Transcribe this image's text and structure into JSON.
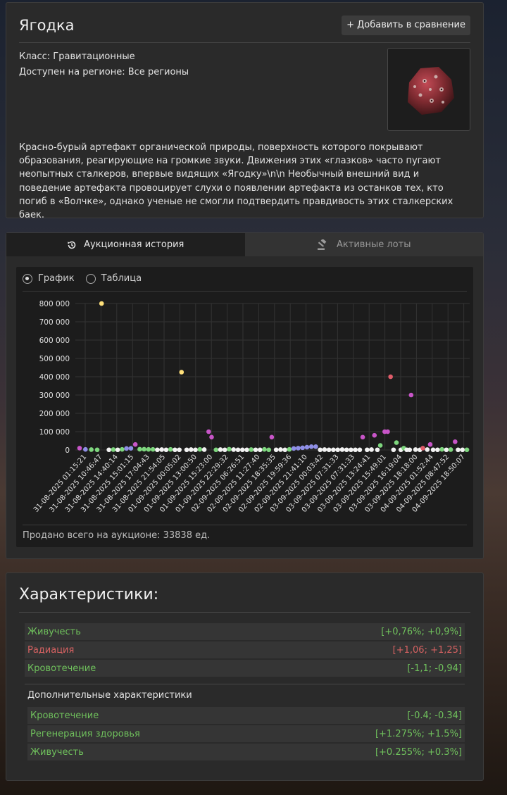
{
  "item": {
    "title": "Ягодка",
    "add_compare_label": "+ Добавить в сравнение",
    "class_line": "Класс: Гравитационные",
    "region_line": "Доступен на регионе: Все регионы",
    "description": "Красно-бурый артефакт органической природы, поверхность которого покрывают образования, реагирующие на громкие звуки. Движения этих «глазков» часто пугают неопытных сталкеров, впервые видящих «Ягодку»\\n\\n Необычный внешний вид и поведение артефакта провоцирует слухи о появлении артефакта из останков тех, кто погиб в «Волчке», однако ученые не смогли подтвердить правдивость этих сталкерских баек.",
    "image_icon": "artifact-image"
  },
  "tabs": {
    "history_label": "Аукционная история",
    "history_icon": "history-icon",
    "lots_label": "Активные лоты",
    "lots_icon": "gavel-icon"
  },
  "view_toggle": {
    "chart_label": "График",
    "table_label": "Таблица",
    "selected": "График"
  },
  "sold_total": "Продано всего на аукционе: 33838 ед.",
  "chart_data": {
    "type": "scatter",
    "ylim": [
      0,
      800000
    ],
    "y_ticks": [
      "800 000",
      "700 000",
      "600 000",
      "500 000",
      "400 000",
      "300 000",
      "200 000",
      "100 000",
      "0"
    ],
    "x_ticks": [
      "31-08-2025 01:15:21",
      "31-08-2025 10:46:47",
      "31-08-2025 14:40:14",
      "31-08-2025 15:01:15",
      "31-08-2025 17:04:43",
      "31-08-2025 21:54:05",
      "01-09-2025 00:05:02",
      "01-09-2025 13:00:50",
      "01-09-2025 15:23:00",
      "01-09-2025 22:29:32",
      "02-09-2025 06:26:51",
      "02-09-2025 11:27:40",
      "02-09-2025 18:35:35",
      "02-09-2025 19:59:36",
      "02-09-2025 21:41:10",
      "03-09-2025 00:03:42",
      "03-09-2025 07:31:33",
      "03-09-2025 07:31:33",
      "03-09-2025 13:24:41",
      "03-09-2025 15:49:01",
      "03-09-2025 16:19:04",
      "03-09-2025 18:18:00",
      "04-09-2025 01:52:44",
      "04-09-2025 08:47:52",
      "04-09-2025 18:50:07"
    ],
    "quality_colors": {
      "common": "#f2f2f2",
      "uncommon": "#7ed67e",
      "special": "#8f8fe6",
      "rare": "#c855c8",
      "exceptional": "#e05c6a",
      "legendary": "#ffe07a"
    },
    "points": [
      {
        "i": 0,
        "y": 10000,
        "q": "rare"
      },
      {
        "i": 0.4,
        "y": 3000,
        "q": "special"
      },
      {
        "i": 0.8,
        "y": 2000,
        "q": "uncommon"
      },
      {
        "i": 1.2,
        "y": 1000,
        "q": "uncommon"
      },
      {
        "i": 1.5,
        "y": 800000,
        "q": "legendary"
      },
      {
        "i": 2.0,
        "y": 1000,
        "q": "common"
      },
      {
        "i": 2.3,
        "y": 2000,
        "q": "uncommon"
      },
      {
        "i": 2.6,
        "y": 1000,
        "q": "common"
      },
      {
        "i": 2.9,
        "y": 3000,
        "q": "uncommon"
      },
      {
        "i": 3.2,
        "y": 8000,
        "q": "special"
      },
      {
        "i": 3.5,
        "y": 9000,
        "q": "special"
      },
      {
        "i": 3.8,
        "y": 30000,
        "q": "rare"
      },
      {
        "i": 4.1,
        "y": 4000,
        "q": "uncommon"
      },
      {
        "i": 4.4,
        "y": 4000,
        "q": "uncommon"
      },
      {
        "i": 4.7,
        "y": 3000,
        "q": "uncommon"
      },
      {
        "i": 5.0,
        "y": 3000,
        "q": "uncommon"
      },
      {
        "i": 5.3,
        "y": 1000,
        "q": "common"
      },
      {
        "i": 5.6,
        "y": 2000,
        "q": "common"
      },
      {
        "i": 5.9,
        "y": 1000,
        "q": "common"
      },
      {
        "i": 6.2,
        "y": 3000,
        "q": "uncommon"
      },
      {
        "i": 6.5,
        "y": 1000,
        "q": "common"
      },
      {
        "i": 6.8,
        "y": 1000,
        "q": "common"
      },
      {
        "i": 6.95,
        "y": 425000,
        "q": "legendary"
      },
      {
        "i": 7.3,
        "y": 1000,
        "q": "common"
      },
      {
        "i": 7.6,
        "y": 2000,
        "q": "common"
      },
      {
        "i": 7.9,
        "y": 1000,
        "q": "common"
      },
      {
        "i": 8.2,
        "y": 3000,
        "q": "uncommon"
      },
      {
        "i": 8.5,
        "y": 2000,
        "q": "common"
      },
      {
        "i": 8.8,
        "y": 100000,
        "q": "rare"
      },
      {
        "i": 9.0,
        "y": 70000,
        "q": "rare"
      },
      {
        "i": 9.3,
        "y": 1000,
        "q": "uncommon"
      },
      {
        "i": 9.6,
        "y": 2000,
        "q": "common"
      },
      {
        "i": 9.9,
        "y": 1000,
        "q": "common"
      },
      {
        "i": 10.2,
        "y": 4000,
        "q": "uncommon"
      },
      {
        "i": 10.5,
        "y": 2000,
        "q": "common"
      },
      {
        "i": 10.8,
        "y": 1000,
        "q": "common"
      },
      {
        "i": 11.1,
        "y": 1000,
        "q": "common"
      },
      {
        "i": 11.4,
        "y": 1000,
        "q": "common"
      },
      {
        "i": 11.7,
        "y": 2000,
        "q": "uncommon"
      },
      {
        "i": 12.0,
        "y": 1000,
        "q": "common"
      },
      {
        "i": 12.3,
        "y": 1000,
        "q": "common"
      },
      {
        "i": 12.6,
        "y": 3000,
        "q": "uncommon"
      },
      {
        "i": 12.9,
        "y": 1000,
        "q": "uncommon"
      },
      {
        "i": 13.1,
        "y": 70000,
        "q": "rare"
      },
      {
        "i": 13.4,
        "y": 1000,
        "q": "common"
      },
      {
        "i": 13.7,
        "y": 2000,
        "q": "common"
      },
      {
        "i": 14.0,
        "y": 1000,
        "q": "common"
      },
      {
        "i": 14.3,
        "y": 3000,
        "q": "uncommon"
      },
      {
        "i": 14.6,
        "y": 8000,
        "q": "special"
      },
      {
        "i": 14.9,
        "y": 10000,
        "q": "special"
      },
      {
        "i": 15.2,
        "y": 12000,
        "q": "special"
      },
      {
        "i": 15.5,
        "y": 15000,
        "q": "special"
      },
      {
        "i": 15.8,
        "y": 18000,
        "q": "special"
      },
      {
        "i": 16.1,
        "y": 18000,
        "q": "special"
      },
      {
        "i": 16.4,
        "y": 1000,
        "q": "common"
      },
      {
        "i": 16.7,
        "y": 2000,
        "q": "common"
      },
      {
        "i": 17.0,
        "y": 1000,
        "q": "common"
      },
      {
        "i": 17.3,
        "y": 1000,
        "q": "common"
      },
      {
        "i": 17.6,
        "y": 1000,
        "q": "common"
      },
      {
        "i": 17.9,
        "y": 2000,
        "q": "common"
      },
      {
        "i": 18.2,
        "y": 1000,
        "q": "common"
      },
      {
        "i": 18.5,
        "y": 1000,
        "q": "common"
      },
      {
        "i": 18.8,
        "y": 1000,
        "q": "common"
      },
      {
        "i": 19.1,
        "y": 1000,
        "q": "common"
      },
      {
        "i": 19.3,
        "y": 70000,
        "q": "rare"
      },
      {
        "i": 19.6,
        "y": 1000,
        "q": "common"
      },
      {
        "i": 19.9,
        "y": 2000,
        "q": "common"
      },
      {
        "i": 20.1,
        "y": 80000,
        "q": "rare"
      },
      {
        "i": 20.3,
        "y": 1000,
        "q": "common"
      },
      {
        "i": 20.5,
        "y": 25000,
        "q": "uncommon"
      },
      {
        "i": 20.8,
        "y": 100000,
        "q": "rare"
      },
      {
        "i": 21.0,
        "y": 100000,
        "q": "rare"
      },
      {
        "i": 21.2,
        "y": 400000,
        "q": "exceptional"
      },
      {
        "i": 21.4,
        "y": 1000,
        "q": "common"
      },
      {
        "i": 21.6,
        "y": 40000,
        "q": "uncommon"
      },
      {
        "i": 21.9,
        "y": 1000,
        "q": "common"
      },
      {
        "i": 22.1,
        "y": 10000,
        "q": "uncommon"
      },
      {
        "i": 22.3,
        "y": 1000,
        "q": "common"
      },
      {
        "i": 22.5,
        "y": 1000,
        "q": "common"
      },
      {
        "i": 22.6,
        "y": 300000,
        "q": "rare"
      },
      {
        "i": 22.9,
        "y": 2000,
        "q": "common"
      },
      {
        "i": 23.2,
        "y": 1000,
        "q": "common"
      },
      {
        "i": 23.4,
        "y": 10000,
        "q": "exceptional"
      },
      {
        "i": 23.7,
        "y": 2000,
        "q": "common"
      },
      {
        "i": 23.9,
        "y": 30000,
        "q": "rare"
      },
      {
        "i": 24.1,
        "y": 1000,
        "q": "common"
      },
      {
        "i": 24.4,
        "y": 1000,
        "q": "common"
      },
      {
        "i": 24.7,
        "y": 3000,
        "q": "uncommon"
      },
      {
        "i": 25.0,
        "y": 1000,
        "q": "common"
      },
      {
        "i": 25.3,
        "y": 2000,
        "q": "uncommon"
      },
      {
        "i": 25.6,
        "y": 45000,
        "q": "rare"
      },
      {
        "i": 25.8,
        "y": 1000,
        "q": "common"
      },
      {
        "i": 26.1,
        "y": 1000,
        "q": "common"
      },
      {
        "i": 26.4,
        "y": 1000,
        "q": "uncommon"
      }
    ]
  },
  "characteristics": {
    "title": "Характеристики:",
    "main": [
      {
        "name": "Живучесть",
        "value": "[+0,76%; +0,9%]",
        "color": "#6fc05c"
      },
      {
        "name": "Радиация",
        "value": "[+1,06; +1,25]",
        "color": "#d76262"
      },
      {
        "name": "Кровотечение",
        "value": "[-1,1; -0,94]",
        "color": "#6fc05c"
      }
    ],
    "extra_title": "Дополнительные характеристики",
    "extra": [
      {
        "name": "Кровотечение",
        "value": "[-0.4; -0.34]",
        "color": "#6fc05c"
      },
      {
        "name": "Регенерация здоровья",
        "value": "[+1.275%; +1.5%]",
        "color": "#6fc05c"
      },
      {
        "name": "Живучесть",
        "value": "[+0.255%; +0.3%]",
        "color": "#6fc05c"
      }
    ]
  }
}
